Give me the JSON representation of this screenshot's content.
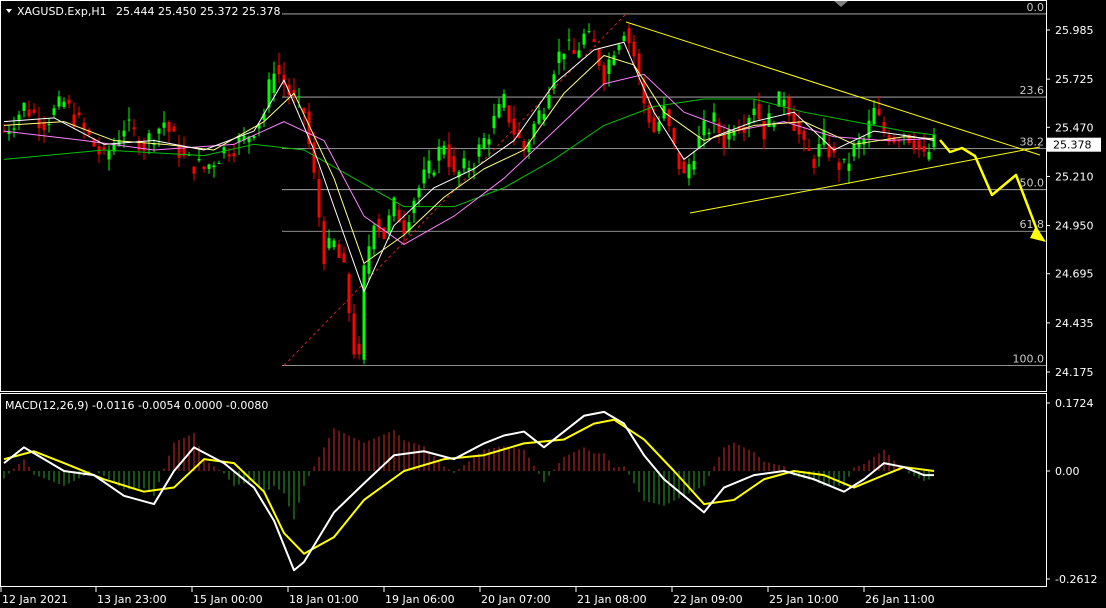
{
  "header": {
    "symbol": "XAGUSD.Exp,H1",
    "ohlc": "25.444 25.450 25.372 25.378"
  },
  "macd": {
    "label": "MACD(12,26,9) -0.0116 -0.0054 0.0000 -0.0080",
    "ticks": [
      "0.1724",
      "0.00",
      "-0.2612"
    ]
  },
  "price_axis": {
    "ticks": [
      "25.985",
      "25.725",
      "25.470",
      "25.210",
      "24.950",
      "24.695",
      "24.435",
      "24.175"
    ],
    "current": "25.378"
  },
  "time_axis": {
    "labels": [
      "12 Jan 2021",
      "13 Jan 23:00",
      "15 Jan 00:00",
      "18 Jan 01:00",
      "19 Jan 06:00",
      "20 Jan 07:00",
      "21 Jan 08:00",
      "22 Jan 09:00",
      "25 Jan 10:00",
      "26 Jan 11:00"
    ]
  },
  "fibonacci": {
    "levels": [
      "0.0",
      "23.6",
      "38.2",
      "50.0",
      "61.8",
      "100.0"
    ],
    "values": [
      26.07,
      25.63,
      25.358,
      25.14,
      24.92,
      24.21
    ]
  },
  "colors": {
    "background": "#000000",
    "bull": "#00ff00",
    "bear": "#ff0000",
    "ma_fast": "#ffffff",
    "ma_mid": "#ffff80",
    "ma_slow": "#ff80ff",
    "ma_long": "#00c000",
    "trendline": "#ffff00",
    "macd_main": "#ffffff",
    "macd_signal": "#ffff00",
    "hist_pos": "#b22222",
    "hist_neg": "#228b22"
  },
  "chart_data": {
    "type": "candlestick",
    "price_range": [
      24.12,
      26.1
    ],
    "macd_range": [
      -0.2612,
      0.1724
    ],
    "close_path": [
      [
        0,
        25.45
      ],
      [
        4,
        25.58
      ],
      [
        8,
        25.5
      ],
      [
        12,
        25.6
      ],
      [
        16,
        25.45
      ],
      [
        20,
        25.3
      ],
      [
        24,
        25.48
      ],
      [
        28,
        25.38
      ],
      [
        32,
        25.5
      ],
      [
        36,
        25.3
      ],
      [
        40,
        25.25
      ],
      [
        44,
        25.35
      ],
      [
        48,
        25.4
      ],
      [
        52,
        25.55
      ],
      [
        54,
        25.8
      ],
      [
        56,
        25.7
      ],
      [
        58,
        25.6
      ],
      [
        60,
        25.55
      ],
      [
        62,
        25.2
      ],
      [
        64,
        24.8
      ],
      [
        66,
        24.85
      ],
      [
        68,
        24.7
      ],
      [
        70,
        24.3
      ],
      [
        71,
        24.22
      ],
      [
        72,
        24.7
      ],
      [
        74,
        25.0
      ],
      [
        76,
        24.9
      ],
      [
        78,
        25.05
      ],
      [
        80,
        24.95
      ],
      [
        82,
        25.1
      ],
      [
        84,
        25.2
      ],
      [
        86,
        25.28
      ],
      [
        88,
        25.4
      ],
      [
        90,
        25.2
      ],
      [
        92,
        25.25
      ],
      [
        94,
        25.3
      ],
      [
        96,
        25.4
      ],
      [
        98,
        25.5
      ],
      [
        100,
        25.6
      ],
      [
        102,
        25.45
      ],
      [
        104,
        25.35
      ],
      [
        106,
        25.48
      ],
      [
        108,
        25.6
      ],
      [
        110,
        25.8
      ],
      [
        112,
        25.9
      ],
      [
        114,
        25.85
      ],
      [
        116,
        25.95
      ],
      [
        118,
        25.9
      ],
      [
        120,
        25.75
      ],
      [
        122,
        25.9
      ],
      [
        124,
        26.0
      ],
      [
        126,
        25.85
      ],
      [
        128,
        25.6
      ],
      [
        130,
        25.45
      ],
      [
        132,
        25.55
      ],
      [
        134,
        25.35
      ],
      [
        136,
        25.2
      ],
      [
        138,
        25.35
      ],
      [
        140,
        25.45
      ],
      [
        142,
        25.5
      ],
      [
        144,
        25.4
      ],
      [
        146,
        25.5
      ],
      [
        148,
        25.5
      ],
      [
        150,
        25.6
      ],
      [
        152,
        25.45
      ],
      [
        154,
        25.55
      ],
      [
        156,
        25.65
      ],
      [
        158,
        25.5
      ],
      [
        160,
        25.35
      ],
      [
        162,
        25.3
      ],
      [
        164,
        25.4
      ],
      [
        166,
        25.3
      ],
      [
        168,
        25.25
      ],
      [
        170,
        25.35
      ],
      [
        172,
        25.4
      ],
      [
        174,
        25.55
      ],
      [
        176,
        25.45
      ],
      [
        178,
        25.42
      ],
      [
        180,
        25.45
      ],
      [
        182,
        25.4
      ],
      [
        184,
        25.3
      ],
      [
        186,
        25.38
      ]
    ],
    "ma_fast_path": [
      [
        0,
        25.5
      ],
      [
        10,
        25.52
      ],
      [
        20,
        25.38
      ],
      [
        30,
        25.4
      ],
      [
        40,
        25.35
      ],
      [
        50,
        25.45
      ],
      [
        56,
        25.72
      ],
      [
        62,
        25.35
      ],
      [
        68,
        24.9
      ],
      [
        72,
        24.6
      ],
      [
        78,
        24.95
      ],
      [
        86,
        25.15
      ],
      [
        94,
        25.25
      ],
      [
        102,
        25.4
      ],
      [
        110,
        25.7
      ],
      [
        118,
        25.88
      ],
      [
        124,
        25.92
      ],
      [
        130,
        25.55
      ],
      [
        136,
        25.3
      ],
      [
        142,
        25.42
      ],
      [
        150,
        25.5
      ],
      [
        158,
        25.55
      ],
      [
        166,
        25.35
      ],
      [
        174,
        25.45
      ],
      [
        182,
        25.42
      ],
      [
        186,
        25.4
      ]
    ],
    "ma_mid_path": [
      [
        0,
        25.48
      ],
      [
        12,
        25.5
      ],
      [
        22,
        25.4
      ],
      [
        32,
        25.38
      ],
      [
        42,
        25.35
      ],
      [
        52,
        25.5
      ],
      [
        58,
        25.65
      ],
      [
        66,
        25.2
      ],
      [
        72,
        24.75
      ],
      [
        80,
        24.9
      ],
      [
        88,
        25.1
      ],
      [
        96,
        25.25
      ],
      [
        104,
        25.35
      ],
      [
        112,
        25.65
      ],
      [
        120,
        25.85
      ],
      [
        126,
        25.8
      ],
      [
        132,
        25.55
      ],
      [
        140,
        25.4
      ],
      [
        150,
        25.48
      ],
      [
        160,
        25.5
      ],
      [
        170,
        25.38
      ],
      [
        180,
        25.42
      ],
      [
        186,
        25.41
      ]
    ],
    "ma_slow_path": [
      [
        0,
        25.45
      ],
      [
        16,
        25.4
      ],
      [
        30,
        25.35
      ],
      [
        46,
        25.38
      ],
      [
        56,
        25.5
      ],
      [
        64,
        25.4
      ],
      [
        72,
        25.0
      ],
      [
        80,
        24.85
      ],
      [
        90,
        25.0
      ],
      [
        100,
        25.2
      ],
      [
        110,
        25.45
      ],
      [
        120,
        25.7
      ],
      [
        128,
        25.75
      ],
      [
        136,
        25.55
      ],
      [
        146,
        25.45
      ],
      [
        156,
        25.5
      ],
      [
        166,
        25.42
      ],
      [
        176,
        25.4
      ],
      [
        186,
        25.41
      ]
    ],
    "ma_long_path": [
      [
        0,
        25.3
      ],
      [
        20,
        25.35
      ],
      [
        40,
        25.32
      ],
      [
        50,
        25.38
      ],
      [
        60,
        25.35
      ],
      [
        70,
        25.2
      ],
      [
        80,
        25.05
      ],
      [
        90,
        25.05
      ],
      [
        100,
        25.15
      ],
      [
        110,
        25.3
      ],
      [
        120,
        25.48
      ],
      [
        130,
        25.58
      ],
      [
        140,
        25.62
      ],
      [
        150,
        25.62
      ],
      [
        160,
        25.55
      ],
      [
        170,
        25.5
      ],
      [
        180,
        25.45
      ],
      [
        186,
        25.43
      ]
    ],
    "macd_main_path": [
      [
        0,
        0.02
      ],
      [
        4,
        0.06
      ],
      [
        8,
        0.03
      ],
      [
        12,
        0.0
      ],
      [
        18,
        -0.01
      ],
      [
        24,
        -0.06
      ],
      [
        30,
        -0.08
      ],
      [
        34,
        0.0
      ],
      [
        38,
        0.06
      ],
      [
        44,
        0.02
      ],
      [
        50,
        -0.04
      ],
      [
        54,
        -0.12
      ],
      [
        58,
        -0.24
      ],
      [
        60,
        -0.22
      ],
      [
        66,
        -0.1
      ],
      [
        72,
        -0.03
      ],
      [
        78,
        0.04
      ],
      [
        84,
        0.05
      ],
      [
        90,
        0.03
      ],
      [
        96,
        0.07
      ],
      [
        100,
        0.09
      ],
      [
        104,
        0.1
      ],
      [
        108,
        0.06
      ],
      [
        112,
        0.1
      ],
      [
        116,
        0.14
      ],
      [
        120,
        0.15
      ],
      [
        124,
        0.12
      ],
      [
        128,
        0.04
      ],
      [
        132,
        -0.02
      ],
      [
        136,
        -0.06
      ],
      [
        140,
        -0.1
      ],
      [
        144,
        -0.04
      ],
      [
        150,
        -0.01
      ],
      [
        156,
        0.0
      ],
      [
        162,
        -0.02
      ],
      [
        168,
        -0.05
      ],
      [
        172,
        -0.02
      ],
      [
        176,
        0.02
      ],
      [
        180,
        0.01
      ],
      [
        184,
        -0.01
      ],
      [
        186,
        -0.01
      ]
    ],
    "macd_signal_path": [
      [
        0,
        0.03
      ],
      [
        6,
        0.05
      ],
      [
        12,
        0.02
      ],
      [
        20,
        -0.02
      ],
      [
        28,
        -0.05
      ],
      [
        34,
        -0.04
      ],
      [
        40,
        0.03
      ],
      [
        46,
        0.02
      ],
      [
        52,
        -0.05
      ],
      [
        56,
        -0.15
      ],
      [
        60,
        -0.2
      ],
      [
        66,
        -0.16
      ],
      [
        72,
        -0.07
      ],
      [
        80,
        0.0
      ],
      [
        88,
        0.03
      ],
      [
        96,
        0.04
      ],
      [
        104,
        0.07
      ],
      [
        112,
        0.08
      ],
      [
        118,
        0.12
      ],
      [
        122,
        0.13
      ],
      [
        128,
        0.08
      ],
      [
        134,
        0.0
      ],
      [
        140,
        -0.08
      ],
      [
        146,
        -0.07
      ],
      [
        152,
        -0.02
      ],
      [
        158,
        0.0
      ],
      [
        164,
        -0.01
      ],
      [
        170,
        -0.04
      ],
      [
        176,
        -0.01
      ],
      [
        180,
        0.01
      ],
      [
        186,
        0.0
      ]
    ]
  }
}
